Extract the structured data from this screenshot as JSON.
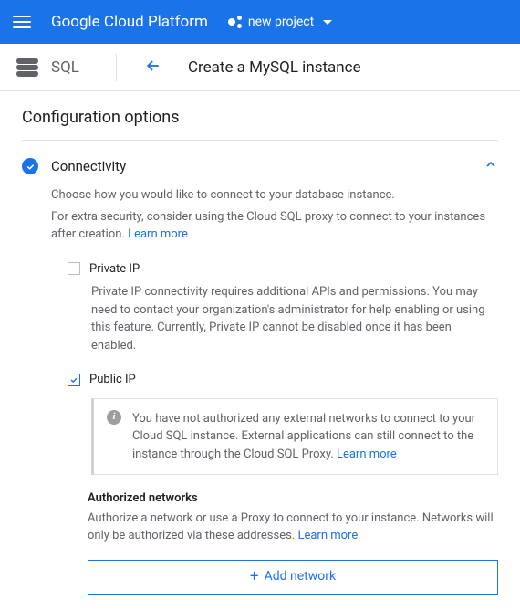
{
  "topbar": {
    "brand": "Google Cloud Platform",
    "project": "new project"
  },
  "subhead": {
    "product": "SQL",
    "page_title": "Create a MySQL instance"
  },
  "config": {
    "heading": "Configuration options"
  },
  "connectivity": {
    "title": "Connectivity",
    "intro": "Choose how you would like to connect to your database instance.",
    "extra": "For extra security, consider using the Cloud SQL proxy to connect to your instances after creation. ",
    "learn_more": "Learn more",
    "private_ip": {
      "label": "Private IP",
      "desc": "Private IP connectivity requires additional APIs and permissions. You may need to contact your organization's administrator for help enabling or using this feature. Currently, Private IP cannot be disabled once it has been enabled."
    },
    "public_ip": {
      "label": "Public IP",
      "info": "You have not authorized any external networks to connect to your Cloud SQL instance. External applications can still connect to the instance through the Cloud SQL Proxy. ",
      "learn_more": "Learn more"
    },
    "auth_networks": {
      "title": "Authorized networks",
      "desc": "Authorize a network or use a Proxy to connect to your instance. Networks will only be authorized via these addresses. ",
      "learn_more": "Learn more",
      "add_button": "Add network"
    }
  }
}
